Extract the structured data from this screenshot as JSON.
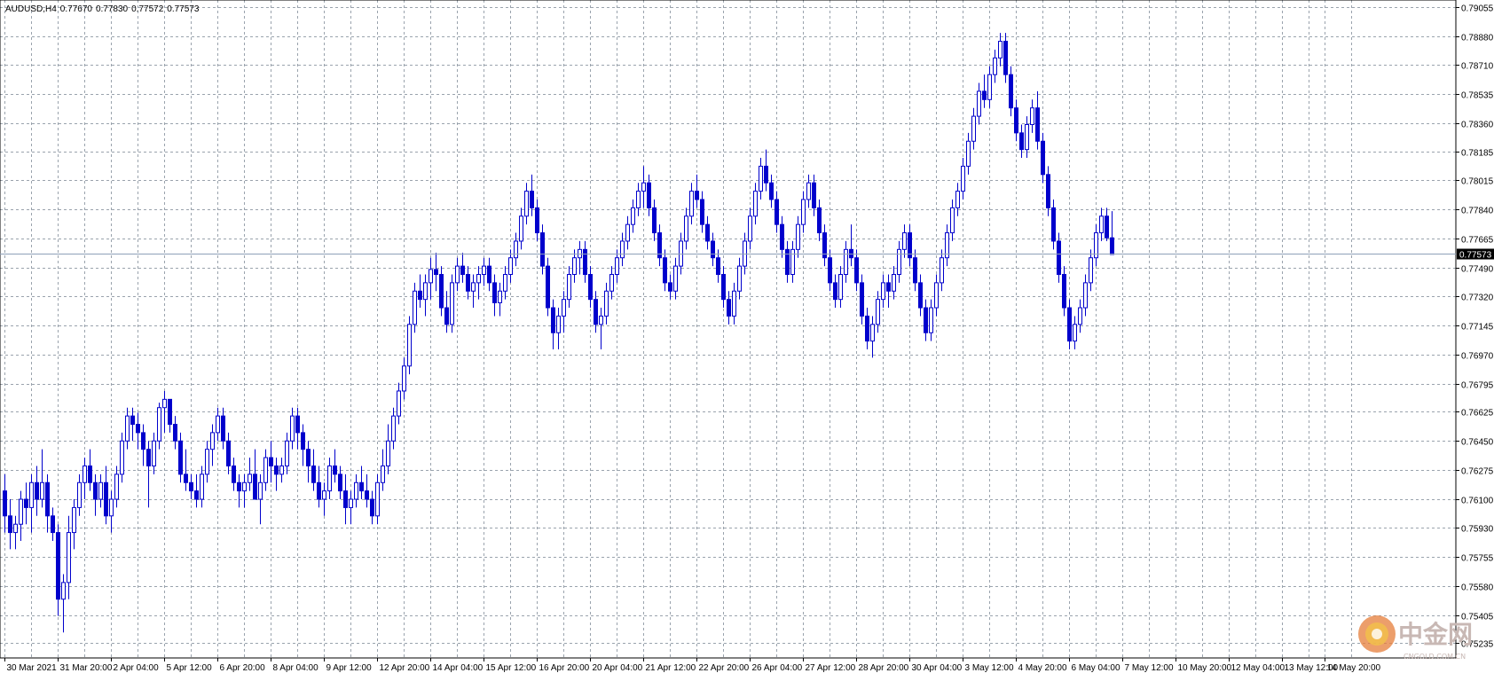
{
  "header": {
    "symbol": "AUDUSD,H4",
    "open": "0.77670",
    "high": "0.77830",
    "low": "0.77572",
    "close": "0.77573"
  },
  "watermark": {
    "text": "中金网",
    "sub": "CNGOLD.COM.CN"
  },
  "colors": {
    "candle": "#0000cc",
    "grid": "#9aa3ad",
    "frame": "#000000",
    "price_line": "#8ea0b8",
    "price_label_bg": "#000000"
  },
  "chart_data": {
    "type": "candlestick",
    "symbol": "AUDUSD",
    "timeframe": "H4",
    "current_price": "0.77573",
    "ylim": [
      0.75147,
      0.79098
    ],
    "y_ticks": [
      "0.79055",
      "0.78880",
      "0.78710",
      "0.78535",
      "0.78360",
      "0.78185",
      "0.78015",
      "0.77840",
      "0.77665",
      "0.77490",
      "0.77320",
      "0.77145",
      "0.76970",
      "0.76795",
      "0.76625",
      "0.76450",
      "0.76275",
      "0.76100",
      "0.75930",
      "0.75755",
      "0.75580",
      "0.75405",
      "0.75235"
    ],
    "x_ticks": [
      {
        "label": "30 Mar 2021",
        "bar": 0
      },
      {
        "label": "31 Mar 20:00",
        "bar": 10
      },
      {
        "label": "2 Apr 04:00",
        "bar": 20
      },
      {
        "label": "5 Apr 12:00",
        "bar": 30
      },
      {
        "label": "6 Apr 20:00",
        "bar": 40
      },
      {
        "label": "8 Apr 04:00",
        "bar": 50
      },
      {
        "label": "9 Apr 12:00",
        "bar": 60
      },
      {
        "label": "12 Apr 20:00",
        "bar": 70
      },
      {
        "label": "14 Apr 04:00",
        "bar": 80
      },
      {
        "label": "15 Apr 12:00",
        "bar": 90
      },
      {
        "label": "16 Apr 20:00",
        "bar": 100
      },
      {
        "label": "20 Apr 04:00",
        "bar": 110
      },
      {
        "label": "21 Apr 12:00",
        "bar": 120
      },
      {
        "label": "22 Apr 20:00",
        "bar": 130
      },
      {
        "label": "26 Apr 04:00",
        "bar": 140
      },
      {
        "label": "27 Apr 12:00",
        "bar": 150
      },
      {
        "label": "28 Apr 20:00",
        "bar": 160
      },
      {
        "label": "30 Apr 04:00",
        "bar": 170
      },
      {
        "label": "3 May 12:00",
        "bar": 180
      },
      {
        "label": "4 May 20:00",
        "bar": 190
      },
      {
        "label": "6 May 04:00",
        "bar": 200
      },
      {
        "label": "7 May 12:00",
        "bar": 210
      },
      {
        "label": "10 May 20:00",
        "bar": 220
      },
      {
        "label": "12 May 04:00",
        "bar": 230
      },
      {
        "label": "13 May 12:00",
        "bar": 240
      },
      {
        "label": "14 May 20:00",
        "bar": 248
      }
    ],
    "candles": [
      [
        0.7615,
        0.7625,
        0.759,
        0.76
      ],
      [
        0.76,
        0.761,
        0.758,
        0.759
      ],
      [
        0.759,
        0.76,
        0.758,
        0.7595
      ],
      [
        0.7595,
        0.7615,
        0.7585,
        0.761
      ],
      [
        0.761,
        0.762,
        0.7595,
        0.7605
      ],
      [
        0.7605,
        0.7625,
        0.759,
        0.762
      ],
      [
        0.762,
        0.763,
        0.76,
        0.761
      ],
      [
        0.761,
        0.764,
        0.7605,
        0.762
      ],
      [
        0.762,
        0.7625,
        0.759,
        0.76
      ],
      [
        0.76,
        0.7605,
        0.7585,
        0.759
      ],
      [
        0.759,
        0.7595,
        0.754,
        0.755
      ],
      [
        0.755,
        0.7565,
        0.753,
        0.756
      ],
      [
        0.756,
        0.76,
        0.755,
        0.759
      ],
      [
        0.759,
        0.761,
        0.758,
        0.7605
      ],
      [
        0.7605,
        0.7625,
        0.76,
        0.762
      ],
      [
        0.762,
        0.7635,
        0.761,
        0.763
      ],
      [
        0.763,
        0.764,
        0.7615,
        0.762
      ],
      [
        0.762,
        0.7625,
        0.76,
        0.761
      ],
      [
        0.761,
        0.7625,
        0.7605,
        0.762
      ],
      [
        0.762,
        0.763,
        0.7595,
        0.76
      ],
      [
        0.76,
        0.7615,
        0.759,
        0.761
      ],
      [
        0.761,
        0.763,
        0.7605,
        0.7625
      ],
      [
        0.7625,
        0.765,
        0.762,
        0.7645
      ],
      [
        0.7645,
        0.7665,
        0.764,
        0.766
      ],
      [
        0.766,
        0.7665,
        0.7645,
        0.7655
      ],
      [
        0.7655,
        0.7662,
        0.764,
        0.765
      ],
      [
        0.765,
        0.7655,
        0.763,
        0.764
      ],
      [
        0.764,
        0.7645,
        0.7605,
        0.763
      ],
      [
        0.763,
        0.765,
        0.7625,
        0.7645
      ],
      [
        0.7645,
        0.7668,
        0.764,
        0.7665
      ],
      [
        0.7665,
        0.7675,
        0.765,
        0.767
      ],
      [
        0.767,
        0.767,
        0.765,
        0.7655
      ],
      [
        0.7655,
        0.766,
        0.764,
        0.7645
      ],
      [
        0.7645,
        0.765,
        0.762,
        0.7625
      ],
      [
        0.7625,
        0.764,
        0.7615,
        0.762
      ],
      [
        0.762,
        0.7625,
        0.761,
        0.7615
      ],
      [
        0.7615,
        0.7625,
        0.7605,
        0.761
      ],
      [
        0.761,
        0.763,
        0.7605,
        0.7625
      ],
      [
        0.7625,
        0.7645,
        0.762,
        0.764
      ],
      [
        0.764,
        0.7655,
        0.763,
        0.765
      ],
      [
        0.765,
        0.7665,
        0.7645,
        0.766
      ],
      [
        0.766,
        0.7665,
        0.764,
        0.7645
      ],
      [
        0.7645,
        0.765,
        0.7625,
        0.763
      ],
      [
        0.763,
        0.7635,
        0.7615,
        0.762
      ],
      [
        0.762,
        0.7625,
        0.7605,
        0.7615
      ],
      [
        0.7615,
        0.7625,
        0.7605,
        0.762
      ],
      [
        0.762,
        0.7635,
        0.7615,
        0.7625
      ],
      [
        0.7625,
        0.764,
        0.7615,
        0.761
      ],
      [
        0.761,
        0.7625,
        0.7595,
        0.762
      ],
      [
        0.762,
        0.764,
        0.7615,
        0.7635
      ],
      [
        0.7635,
        0.7645,
        0.762,
        0.763
      ],
      [
        0.763,
        0.7635,
        0.7615,
        0.7625
      ],
      [
        0.7625,
        0.7635,
        0.762,
        0.763
      ],
      [
        0.763,
        0.765,
        0.7625,
        0.7645
      ],
      [
        0.7645,
        0.7665,
        0.764,
        0.766
      ],
      [
        0.766,
        0.7665,
        0.764,
        0.765
      ],
      [
        0.765,
        0.7655,
        0.763,
        0.764
      ],
      [
        0.764,
        0.7645,
        0.762,
        0.763
      ],
      [
        0.763,
        0.764,
        0.7615,
        0.762
      ],
      [
        0.762,
        0.763,
        0.7605,
        0.761
      ],
      [
        0.761,
        0.762,
        0.76,
        0.7615
      ],
      [
        0.7615,
        0.7635,
        0.761,
        0.763
      ],
      [
        0.763,
        0.764,
        0.762,
        0.7625
      ],
      [
        0.7625,
        0.763,
        0.761,
        0.7615
      ],
      [
        0.7615,
        0.7625,
        0.7595,
        0.7605
      ],
      [
        0.7605,
        0.7615,
        0.7595,
        0.761
      ],
      [
        0.761,
        0.7625,
        0.7605,
        0.762
      ],
      [
        0.762,
        0.763,
        0.761,
        0.7615
      ],
      [
        0.7615,
        0.7625,
        0.7605,
        0.761
      ],
      [
        0.761,
        0.7615,
        0.7595,
        0.76
      ],
      [
        0.76,
        0.7625,
        0.7595,
        0.762
      ],
      [
        0.762,
        0.764,
        0.7615,
        0.763
      ],
      [
        0.763,
        0.7655,
        0.7625,
        0.7645
      ],
      [
        0.7645,
        0.7665,
        0.764,
        0.766
      ],
      [
        0.766,
        0.768,
        0.7655,
        0.7675
      ],
      [
        0.7675,
        0.7695,
        0.767,
        0.769
      ],
      [
        0.769,
        0.772,
        0.7685,
        0.7715
      ],
      [
        0.7715,
        0.774,
        0.771,
        0.7735
      ],
      [
        0.7735,
        0.7745,
        0.7725,
        0.773
      ],
      [
        0.773,
        0.7745,
        0.772,
        0.774
      ],
      [
        0.774,
        0.7755,
        0.773,
        0.7748
      ],
      [
        0.7748,
        0.7758,
        0.7735,
        0.7745
      ],
      [
        0.7745,
        0.775,
        0.772,
        0.7725
      ],
      [
        0.7725,
        0.7735,
        0.771,
        0.7715
      ],
      [
        0.7715,
        0.7745,
        0.771,
        0.774
      ],
      [
        0.774,
        0.7755,
        0.7735,
        0.775
      ],
      [
        0.775,
        0.7758,
        0.774,
        0.7745
      ],
      [
        0.7745,
        0.775,
        0.773,
        0.7735
      ],
      [
        0.7735,
        0.7745,
        0.7725,
        0.774
      ],
      [
        0.774,
        0.775,
        0.773,
        0.7745
      ],
      [
        0.7745,
        0.7755,
        0.7738,
        0.775
      ],
      [
        0.775,
        0.7755,
        0.7735,
        0.774
      ],
      [
        0.774,
        0.7745,
        0.772,
        0.7728
      ],
      [
        0.7728,
        0.774,
        0.772,
        0.7735
      ],
      [
        0.7735,
        0.775,
        0.773,
        0.7745
      ],
      [
        0.7745,
        0.776,
        0.774,
        0.7755
      ],
      [
        0.7755,
        0.777,
        0.775,
        0.7765
      ],
      [
        0.7765,
        0.7785,
        0.776,
        0.778
      ],
      [
        0.778,
        0.78,
        0.7775,
        0.7795
      ],
      [
        0.7795,
        0.7805,
        0.778,
        0.7785
      ],
      [
        0.7785,
        0.779,
        0.7765,
        0.777
      ],
      [
        0.777,
        0.7775,
        0.7745,
        0.775
      ],
      [
        0.775,
        0.7755,
        0.772,
        0.7725
      ],
      [
        0.7725,
        0.773,
        0.77,
        0.771
      ],
      [
        0.771,
        0.7725,
        0.77,
        0.772
      ],
      [
        0.772,
        0.7735,
        0.771,
        0.773
      ],
      [
        0.773,
        0.775,
        0.7725,
        0.7745
      ],
      [
        0.7745,
        0.776,
        0.774,
        0.7755
      ],
      [
        0.7755,
        0.7765,
        0.7745,
        0.776
      ],
      [
        0.776,
        0.7765,
        0.774,
        0.7745
      ],
      [
        0.7745,
        0.775,
        0.7725,
        0.773
      ],
      [
        0.773,
        0.7735,
        0.771,
        0.7715
      ],
      [
        0.7715,
        0.7725,
        0.77,
        0.772
      ],
      [
        0.772,
        0.774,
        0.7715,
        0.7735
      ],
      [
        0.7735,
        0.775,
        0.773,
        0.7745
      ],
      [
        0.7745,
        0.776,
        0.774,
        0.7755
      ],
      [
        0.7755,
        0.777,
        0.775,
        0.7765
      ],
      [
        0.7765,
        0.778,
        0.776,
        0.7775
      ],
      [
        0.7775,
        0.779,
        0.777,
        0.7785
      ],
      [
        0.7785,
        0.78,
        0.778,
        0.7795
      ],
      [
        0.7795,
        0.781,
        0.7785,
        0.78
      ],
      [
        0.78,
        0.7805,
        0.778,
        0.7785
      ],
      [
        0.7785,
        0.779,
        0.7765,
        0.777
      ],
      [
        0.777,
        0.7775,
        0.775,
        0.7755
      ],
      [
        0.7755,
        0.776,
        0.7735,
        0.774
      ],
      [
        0.774,
        0.7745,
        0.773,
        0.7735
      ],
      [
        0.7735,
        0.7755,
        0.773,
        0.775
      ],
      [
        0.775,
        0.777,
        0.7745,
        0.7765
      ],
      [
        0.7765,
        0.7785,
        0.776,
        0.778
      ],
      [
        0.778,
        0.78,
        0.7775,
        0.7795
      ],
      [
        0.7795,
        0.7805,
        0.7785,
        0.779
      ],
      [
        0.779,
        0.7795,
        0.777,
        0.7775
      ],
      [
        0.7775,
        0.778,
        0.776,
        0.7765
      ],
      [
        0.7765,
        0.777,
        0.775,
        0.7755
      ],
      [
        0.7755,
        0.776,
        0.774,
        0.7745
      ],
      [
        0.7745,
        0.775,
        0.7725,
        0.773
      ],
      [
        0.773,
        0.7735,
        0.7715,
        0.772
      ],
      [
        0.772,
        0.774,
        0.7715,
        0.7735
      ],
      [
        0.7735,
        0.7755,
        0.773,
        0.775
      ],
      [
        0.775,
        0.777,
        0.7745,
        0.7765
      ],
      [
        0.7765,
        0.7785,
        0.776,
        0.778
      ],
      [
        0.778,
        0.78,
        0.7775,
        0.7795
      ],
      [
        0.7795,
        0.7815,
        0.779,
        0.781
      ],
      [
        0.781,
        0.782,
        0.7795,
        0.78
      ],
      [
        0.78,
        0.7805,
        0.7785,
        0.779
      ],
      [
        0.779,
        0.7795,
        0.777,
        0.7775
      ],
      [
        0.7775,
        0.778,
        0.7755,
        0.776
      ],
      [
        0.776,
        0.7765,
        0.774,
        0.7745
      ],
      [
        0.7745,
        0.7765,
        0.774,
        0.776
      ],
      [
        0.776,
        0.778,
        0.7755,
        0.7775
      ],
      [
        0.7775,
        0.7795,
        0.777,
        0.779
      ],
      [
        0.779,
        0.7805,
        0.7785,
        0.78
      ],
      [
        0.78,
        0.7805,
        0.778,
        0.7785
      ],
      [
        0.7785,
        0.779,
        0.7765,
        0.777
      ],
      [
        0.777,
        0.7775,
        0.775,
        0.7755
      ],
      [
        0.7755,
        0.776,
        0.7735,
        0.774
      ],
      [
        0.774,
        0.7745,
        0.7725,
        0.773
      ],
      [
        0.773,
        0.775,
        0.7725,
        0.7745
      ],
      [
        0.7745,
        0.7765,
        0.774,
        0.776
      ],
      [
        0.776,
        0.7775,
        0.775,
        0.7755
      ],
      [
        0.7755,
        0.776,
        0.7735,
        0.774
      ],
      [
        0.774,
        0.7745,
        0.7715,
        0.772
      ],
      [
        0.772,
        0.7725,
        0.77,
        0.7705
      ],
      [
        0.7705,
        0.772,
        0.7695,
        0.7715
      ],
      [
        0.7715,
        0.7735,
        0.771,
        0.773
      ],
      [
        0.773,
        0.7745,
        0.7725,
        0.774
      ],
      [
        0.774,
        0.7745,
        0.7725,
        0.7735
      ],
      [
        0.7735,
        0.775,
        0.773,
        0.7745
      ],
      [
        0.7745,
        0.7765,
        0.774,
        0.776
      ],
      [
        0.776,
        0.7775,
        0.7755,
        0.777
      ],
      [
        0.777,
        0.7775,
        0.775,
        0.7755
      ],
      [
        0.7755,
        0.776,
        0.7735,
        0.774
      ],
      [
        0.774,
        0.7745,
        0.772,
        0.7725
      ],
      [
        0.7725,
        0.773,
        0.7705,
        0.771
      ],
      [
        0.771,
        0.773,
        0.7705,
        0.7725
      ],
      [
        0.7725,
        0.7745,
        0.772,
        0.774
      ],
      [
        0.774,
        0.776,
        0.7735,
        0.7755
      ],
      [
        0.7755,
        0.7775,
        0.775,
        0.777
      ],
      [
        0.777,
        0.779,
        0.7765,
        0.7785
      ],
      [
        0.7785,
        0.78,
        0.778,
        0.7795
      ],
      [
        0.7795,
        0.7815,
        0.779,
        0.781
      ],
      [
        0.781,
        0.783,
        0.7805,
        0.7825
      ],
      [
        0.7825,
        0.7845,
        0.782,
        0.784
      ],
      [
        0.784,
        0.786,
        0.7835,
        0.7855
      ],
      [
        0.7855,
        0.7865,
        0.7845,
        0.785
      ],
      [
        0.785,
        0.787,
        0.7845,
        0.7865
      ],
      [
        0.7865,
        0.788,
        0.786,
        0.7875
      ],
      [
        0.7875,
        0.789,
        0.787,
        0.7885
      ],
      [
        0.7885,
        0.789,
        0.786,
        0.7865
      ],
      [
        0.7865,
        0.787,
        0.784,
        0.7845
      ],
      [
        0.7845,
        0.785,
        0.7825,
        0.783
      ],
      [
        0.783,
        0.7835,
        0.7815,
        0.782
      ],
      [
        0.782,
        0.784,
        0.7815,
        0.7835
      ],
      [
        0.7835,
        0.785,
        0.783,
        0.7845
      ],
      [
        0.7845,
        0.7855,
        0.782,
        0.7825
      ],
      [
        0.7825,
        0.783,
        0.78,
        0.7805
      ],
      [
        0.7805,
        0.781,
        0.778,
        0.7785
      ],
      [
        0.7785,
        0.779,
        0.776,
        0.7765
      ],
      [
        0.7765,
        0.777,
        0.774,
        0.7745
      ],
      [
        0.7745,
        0.775,
        0.772,
        0.7725
      ],
      [
        0.7725,
        0.773,
        0.77,
        0.7705
      ],
      [
        0.7705,
        0.772,
        0.77,
        0.7715
      ],
      [
        0.7715,
        0.773,
        0.771,
        0.7725
      ],
      [
        0.7725,
        0.7745,
        0.772,
        0.774
      ],
      [
        0.774,
        0.776,
        0.7735,
        0.7755
      ],
      [
        0.7755,
        0.7775,
        0.775,
        0.777
      ],
      [
        0.777,
        0.7785,
        0.7765,
        0.778
      ],
      [
        0.778,
        0.7785,
        0.7765,
        0.7767
      ],
      [
        0.7767,
        0.7783,
        0.7757,
        0.7757
      ]
    ]
  }
}
